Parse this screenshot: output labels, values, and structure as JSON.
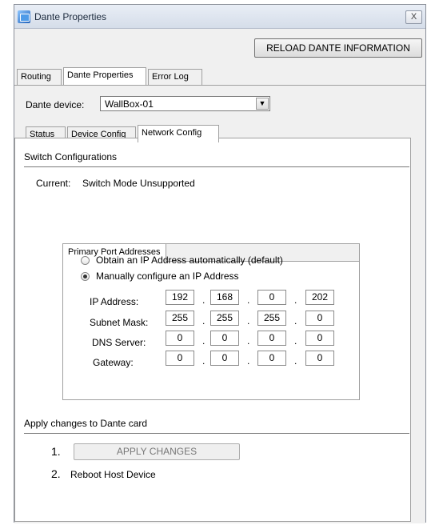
{
  "window": {
    "title": "Dante Properties",
    "close_glyph": "X"
  },
  "toolbar": {
    "reload_label": "RELOAD DANTE INFORMATION"
  },
  "main_tabs": [
    {
      "label": "Routing"
    },
    {
      "label": "Dante Properties"
    },
    {
      "label": "Error Log"
    }
  ],
  "device": {
    "label": "Dante device:",
    "selected": "WallBox-01"
  },
  "sub_tabs": [
    {
      "label": "Status"
    },
    {
      "label": "Device Config"
    },
    {
      "label": "Network Config"
    }
  ],
  "switch": {
    "heading": "Switch Configurations",
    "current_label": "Current:",
    "current_value": "Switch Mode Unsupported"
  },
  "primary_port": {
    "tab_label": "Primary Port Addresses",
    "option_auto": "Obtain an IP Address automatically (default)",
    "option_manual": "Manually configure an IP Address",
    "fields": [
      {
        "label": "IP Address:",
        "octets": [
          "192",
          "168",
          "0",
          "202"
        ]
      },
      {
        "label": "Subnet Mask:",
        "octets": [
          "255",
          "255",
          "255",
          "0"
        ]
      },
      {
        "label": "DNS Server:",
        "octets": [
          "0",
          "0",
          "0",
          "0"
        ]
      },
      {
        "label": "Gateway:",
        "octets": [
          "0",
          "0",
          "0",
          "0"
        ]
      }
    ]
  },
  "apply": {
    "heading": "Apply changes to Dante card",
    "step1_num": "1.",
    "step1_button": "APPLY CHANGES",
    "step2_num": "2.",
    "step2_text": "Reboot Host Device"
  }
}
